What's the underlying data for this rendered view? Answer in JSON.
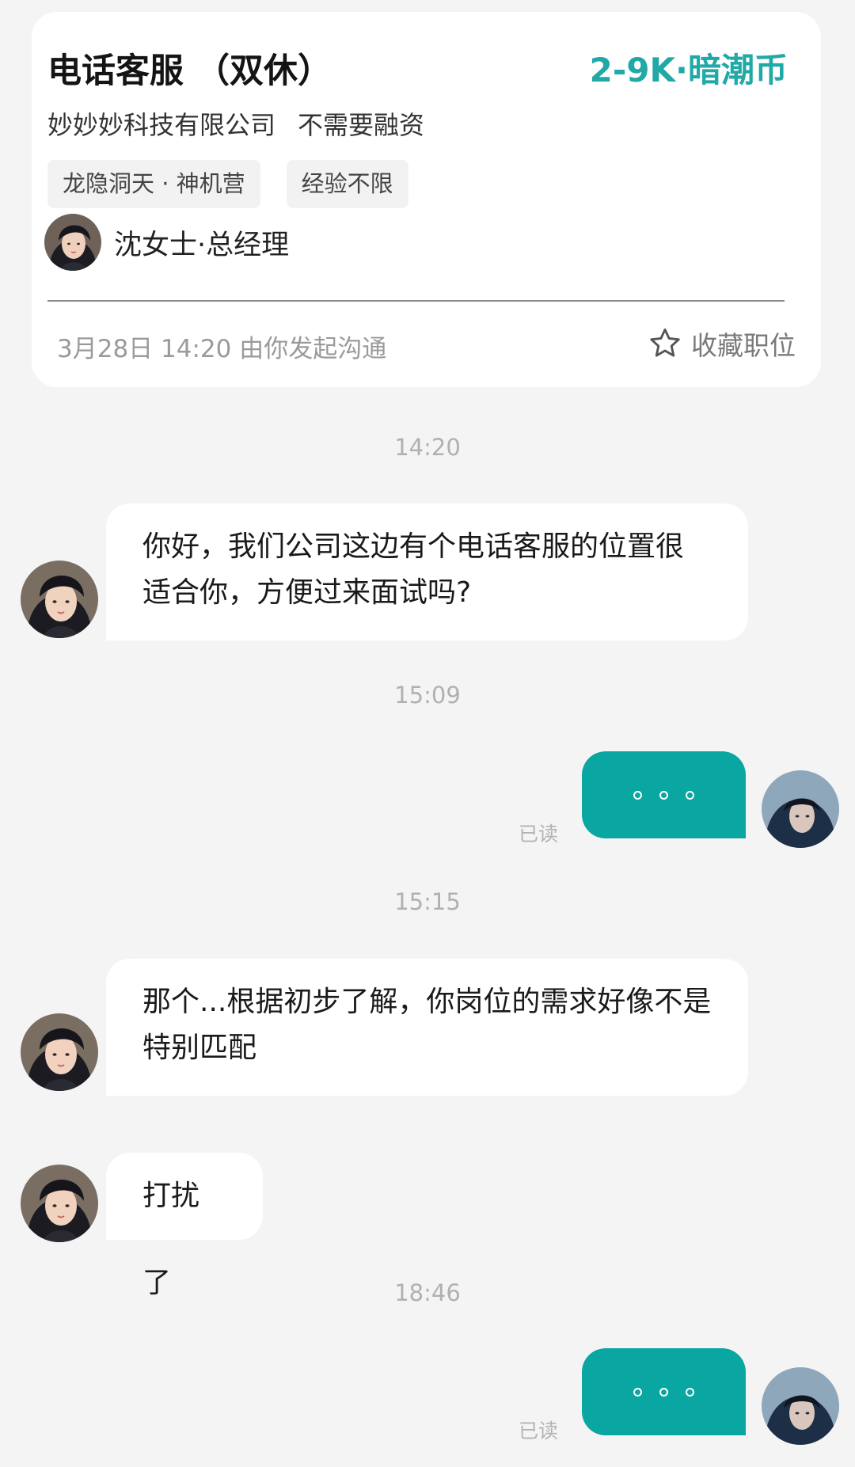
{
  "job_card": {
    "title": "电话客服 （双休）",
    "salary": "2-9K·暗潮币",
    "company": "妙妙妙科技有限公司",
    "funding": "不需要融资",
    "tags": [
      "龙隐洞天 · 神机营",
      "经验不限"
    ],
    "recruiter": "沈女士·总经理",
    "meta": "3月28日  14:20 由你发起沟通",
    "favorite_label": "收藏职位"
  },
  "colors": {
    "accent": "#20a9a6",
    "bubble_out": "#0aa6a1",
    "bubble_in": "#ffffff",
    "background": "#f4f4f4"
  },
  "chat": {
    "times": [
      "14:20",
      "15:09",
      "15:15",
      "18:46"
    ],
    "messages": {
      "m1": {
        "text": "你好，我们公司这边有个电话客服的位置很适合你，方便过来面试吗?"
      },
      "m2": {
        "text": "。。。",
        "status": "已读"
      },
      "m3": {
        "text": "那个...根据初步了解，你岗位的需求好像不是特别匹配"
      },
      "m4": {
        "text": "打扰了"
      },
      "m5": {
        "text": "。。。",
        "status": "已读"
      }
    }
  }
}
